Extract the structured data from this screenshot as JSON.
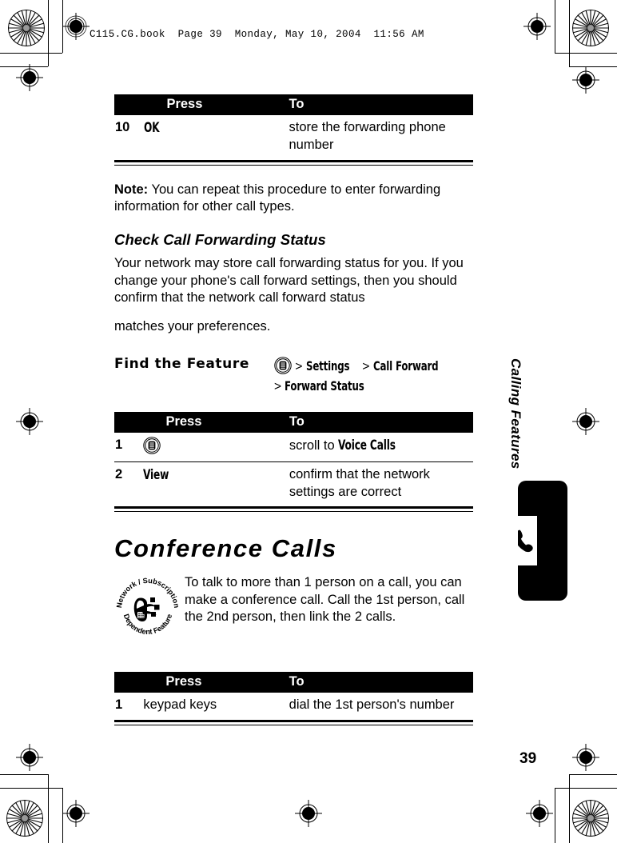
{
  "print_header": "C115.CG.book  Page 39  Monday, May 10, 2004  11:56 AM",
  "page_number": "39",
  "running_head": "Calling Features",
  "table1": {
    "headers": {
      "num": "",
      "press": "Press",
      "to": "To"
    },
    "rows": [
      {
        "num": "10",
        "press": "OK",
        "press_style": "key",
        "to": "store the forwarding phone number"
      }
    ]
  },
  "note": {
    "label": "Note:",
    "text": " You can repeat this procedure to enter forwarding information for other call types."
  },
  "subhead": "Check Call Forwarding Status",
  "paragraph1": "Your network may store call forwarding status for you. If you change your phone's call forward settings, then you should confirm that the network call forward status",
  "paragraph1_last_line": "matches your preferences.",
  "find_the_feature": {
    "label": "Find the Feature",
    "menu_icon": "menu-key-icon",
    "path_line1_sep1": ">",
    "path_item1": "Settings",
    "path_sep2": ">",
    "path_item2": "Call Forward",
    "path_line2_sep": ">",
    "path_item3": "Forward Status"
  },
  "table2": {
    "headers": {
      "num": "",
      "press": "Press",
      "to": "To"
    },
    "rows": [
      {
        "num": "1",
        "press_icon": "menu-key-icon",
        "to_prefix": "scroll to ",
        "to_key": "Voice Calls"
      },
      {
        "num": "2",
        "press": "View",
        "press_style": "key",
        "to": "confirm that the network settings are correct"
      }
    ]
  },
  "chapter_title": "Conference Calls",
  "badge": {
    "icon": "network-subscription-dependent-feature-badge",
    "text_top": "Network / Subscription",
    "text_bottom": "Dependent Feature"
  },
  "conference_text": "To talk to more than 1 person on a call, you can make a conference call. Call the 1st person, call the 2nd person, then link the 2 calls.",
  "table3": {
    "headers": {
      "num": "",
      "press": "Press",
      "to": "To"
    },
    "rows": [
      {
        "num": "1",
        "press": "keypad keys",
        "press_style": "plain",
        "to": "dial the 1st person's number"
      }
    ]
  },
  "colors": {
    "header_bar": "#000000",
    "header_text": "#ffffff",
    "body_text": "#000000",
    "page_background": "#ffffff"
  }
}
